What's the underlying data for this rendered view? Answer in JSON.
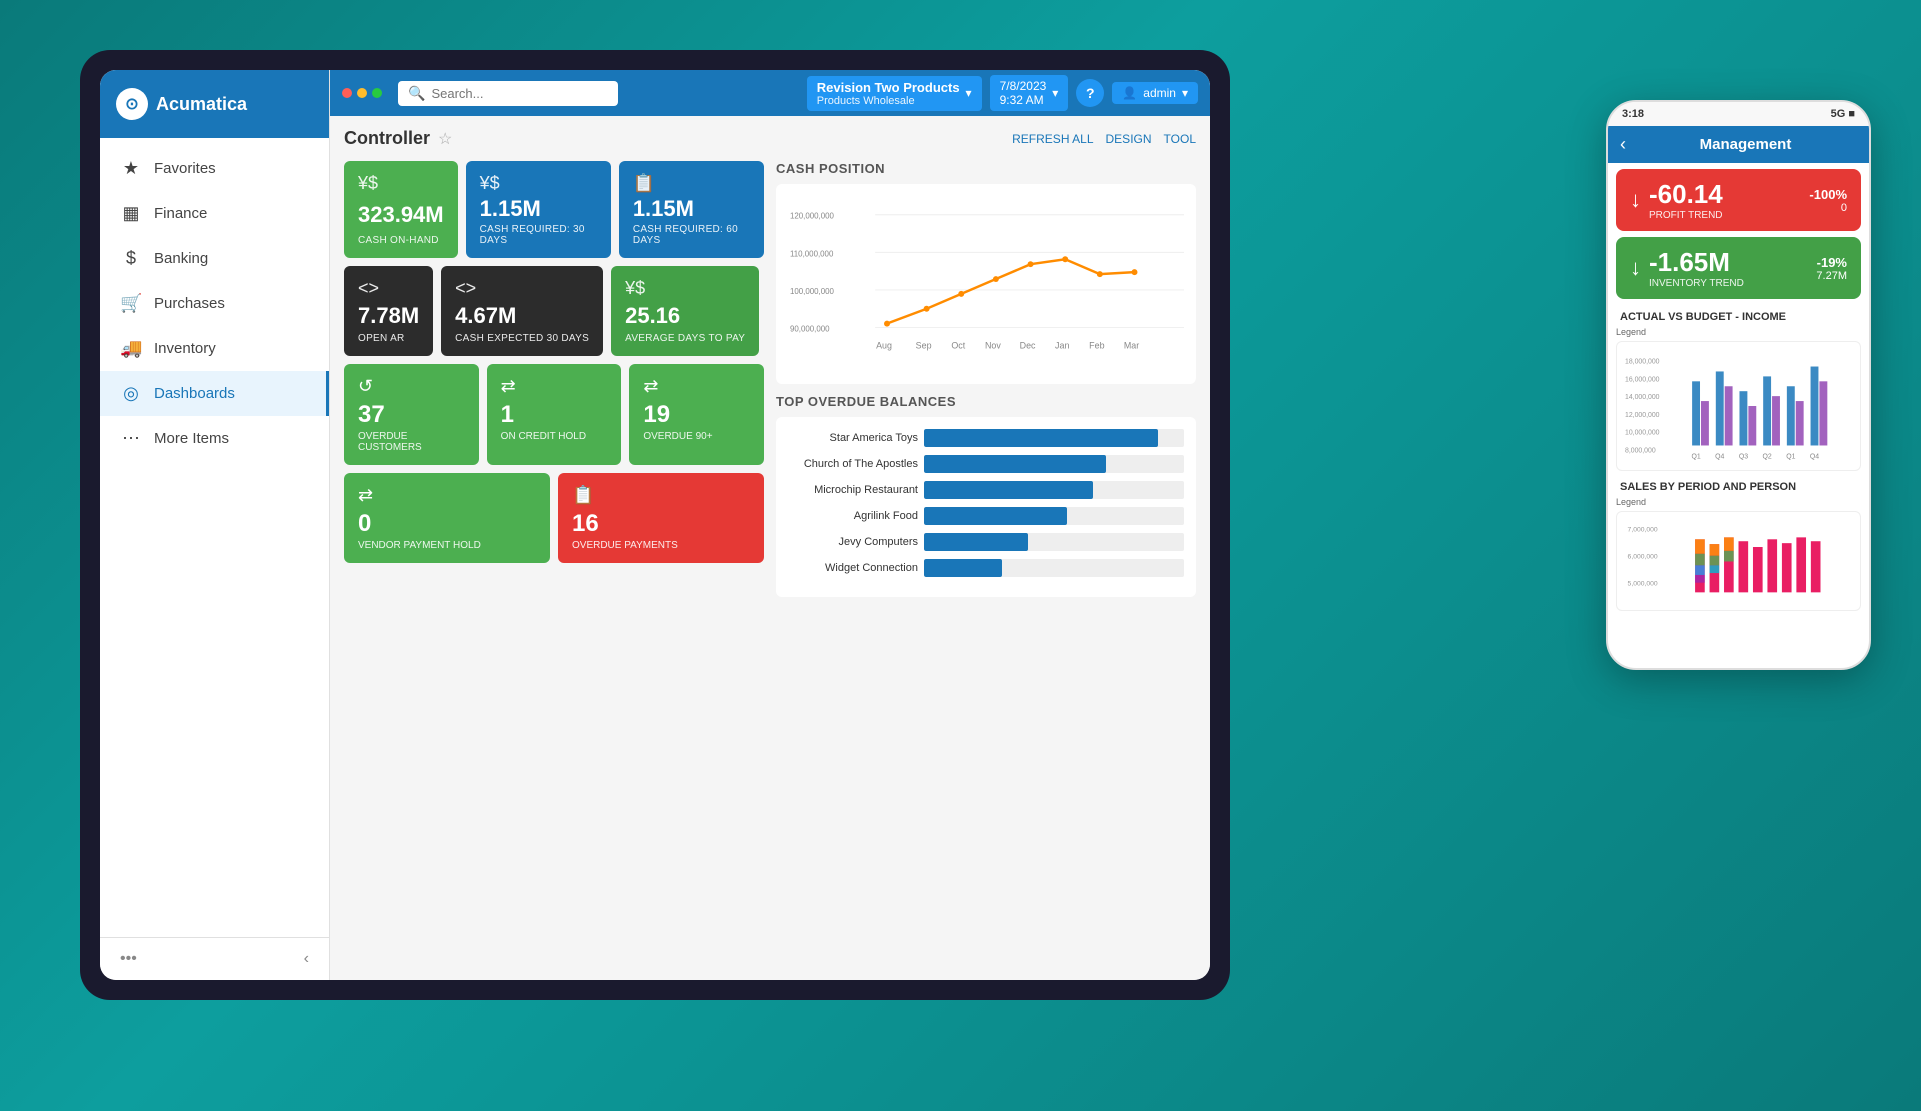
{
  "app": {
    "name": "Acumatica",
    "logo_symbol": "⊙"
  },
  "sidebar": {
    "items": [
      {
        "id": "favorites",
        "label": "Favorites",
        "icon": "★",
        "active": false
      },
      {
        "id": "finance",
        "label": "Finance",
        "icon": "▦",
        "active": false
      },
      {
        "id": "banking",
        "label": "Banking",
        "icon": "$",
        "active": false
      },
      {
        "id": "purchases",
        "label": "Purchases",
        "icon": "🛒",
        "active": false
      },
      {
        "id": "inventory",
        "label": "Inventory",
        "icon": "🚚",
        "active": false
      },
      {
        "id": "dashboards",
        "label": "Dashboards",
        "icon": "◎",
        "active": true
      },
      {
        "id": "more-items",
        "label": "More Items",
        "icon": "⋯",
        "active": false
      }
    ],
    "collapse_label": "•••",
    "collapse_arrow": "‹"
  },
  "topbar": {
    "search_placeholder": "Search...",
    "company_name": "Revision Two Products",
    "company_sub": "Products Wholesale",
    "date": "7/8/2023",
    "time": "9:32 AM",
    "help_label": "?",
    "user_label": "admin",
    "refresh_label": "REFRESH ALL",
    "design_label": "DESIGN",
    "tools_label": "TOOL"
  },
  "page": {
    "title": "Controller",
    "subtitle": ""
  },
  "top_metrics": [
    {
      "icon": "¥$",
      "value": "323.94M",
      "label": "CASH ON-HAND",
      "color": "green"
    },
    {
      "icon": "¥$",
      "value": "1.15M",
      "label": "CASH REQUIRED: 30 DAYS",
      "color": "blue"
    },
    {
      "icon": "📋",
      "value": "1.15M",
      "label": "CASH REQUIRED: 60 DAYS",
      "color": "blue"
    }
  ],
  "mid_metrics": [
    {
      "icon": "<>",
      "value": "7.78M",
      "label": "OPEN AR",
      "color": "dark"
    },
    {
      "icon": "<>",
      "value": "4.67M",
      "label": "CASH EXPECTED 30 DAYS",
      "color": "dark"
    },
    {
      "icon": "¥$",
      "value": "25.16",
      "label": "AVERAGE DAYS TO PAY",
      "color": "green-2"
    }
  ],
  "cash_position": {
    "title": "CASH POSITION",
    "y_labels": [
      "120,000,000",
      "110,000,000",
      "100,000,000",
      "90,000,000"
    ],
    "x_labels": [
      "Aug",
      "Sep",
      "Oct",
      "Nov",
      "Dec",
      "Jan",
      "Feb",
      "Mar"
    ]
  },
  "overdue_section": {
    "title": "TOP OVERDUE BALANCES",
    "items": [
      {
        "name": "Star America Toys",
        "pct": 90
      },
      {
        "name": "Church of The Apostles",
        "pct": 70
      },
      {
        "name": "Microchip Restaurant",
        "pct": 65
      },
      {
        "name": "Agrilink Food",
        "pct": 55
      },
      {
        "name": "Jevy Computers",
        "pct": 40
      },
      {
        "name": "Widget Connection",
        "pct": 30
      }
    ]
  },
  "bottom_metrics": [
    {
      "icon": "↺",
      "value": "37",
      "label": "OVERDUE CUSTOMERS",
      "color": "green"
    },
    {
      "icon": "⇄",
      "value": "1",
      "label": "ON CREDIT HOLD",
      "color": "green"
    },
    {
      "icon": "⇄",
      "value": "19",
      "label": "OVERDUE 90+",
      "color": "green"
    }
  ],
  "bottom_metrics2": [
    {
      "icon": "⇄",
      "value": "0",
      "label": "VENDOR PAYMENT HOLD",
      "color": "green"
    },
    {
      "icon": "📋",
      "value": "16",
      "label": "OVERDUE PAYMENTS",
      "color": "red"
    }
  ],
  "mobile": {
    "status_time": "3:18",
    "status_signal": "5G ■",
    "title": "Management",
    "back_label": "‹",
    "cards": [
      {
        "arrow": "↓",
        "value": "-60.14",
        "label": "PROFIT TREND",
        "pct": "-100%",
        "sub": "0",
        "color": "red"
      },
      {
        "arrow": "↓",
        "value": "-1.65M",
        "label": "INVENTORY TREND",
        "pct": "-19%",
        "sub": "7.27M",
        "color": "green"
      }
    ],
    "chart1_title": "ACTUAL VS BUDGET - INCOME",
    "chart1_legend": "Legend",
    "chart1_y_labels": [
      "18,000,000",
      "16,000,000",
      "14,000,000",
      "12,000,000",
      "10,000,000",
      "8,000,000"
    ],
    "chart1_x_labels": [
      "Q1",
      "Q4",
      "Q3",
      "Q2",
      "Q1",
      "Q4"
    ],
    "chart2_title": "SALES BY PERIOD AND PERSON",
    "chart2_legend": "Legend",
    "chart2_y_labels": [
      "7,000,000",
      "6,000,000",
      "5,000,000"
    ]
  }
}
